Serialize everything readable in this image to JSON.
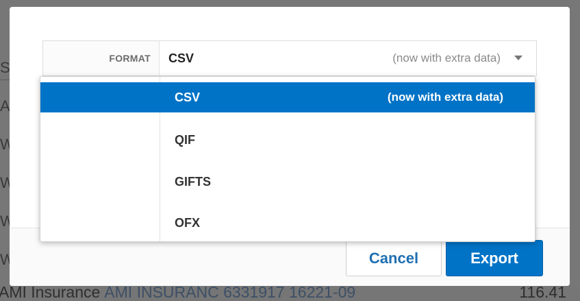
{
  "background": {
    "row_letters": [
      "S",
      "A",
      "W",
      "W",
      "W",
      "W"
    ],
    "bottom_row": {
      "payee": "AMI Insurance",
      "memo": "AMI INSURANC 6331917 16221-09",
      "amount": "116.41"
    }
  },
  "format_field": {
    "label": "FORMAT",
    "selected_value": "CSV",
    "selected_note": "(now with extra data)"
  },
  "dropdown": {
    "options": [
      {
        "label": "CSV",
        "note": "(now with extra data)",
        "selected": true
      },
      {
        "label": "QIF",
        "note": ""
      },
      {
        "label": "GIFTS",
        "note": ""
      },
      {
        "label": "OFX",
        "note": ""
      }
    ]
  },
  "footer": {
    "cancel_label": "Cancel",
    "export_label": "Export"
  },
  "colors": {
    "accent": "#0073c6",
    "cancel_text": "#1f6fb2"
  }
}
